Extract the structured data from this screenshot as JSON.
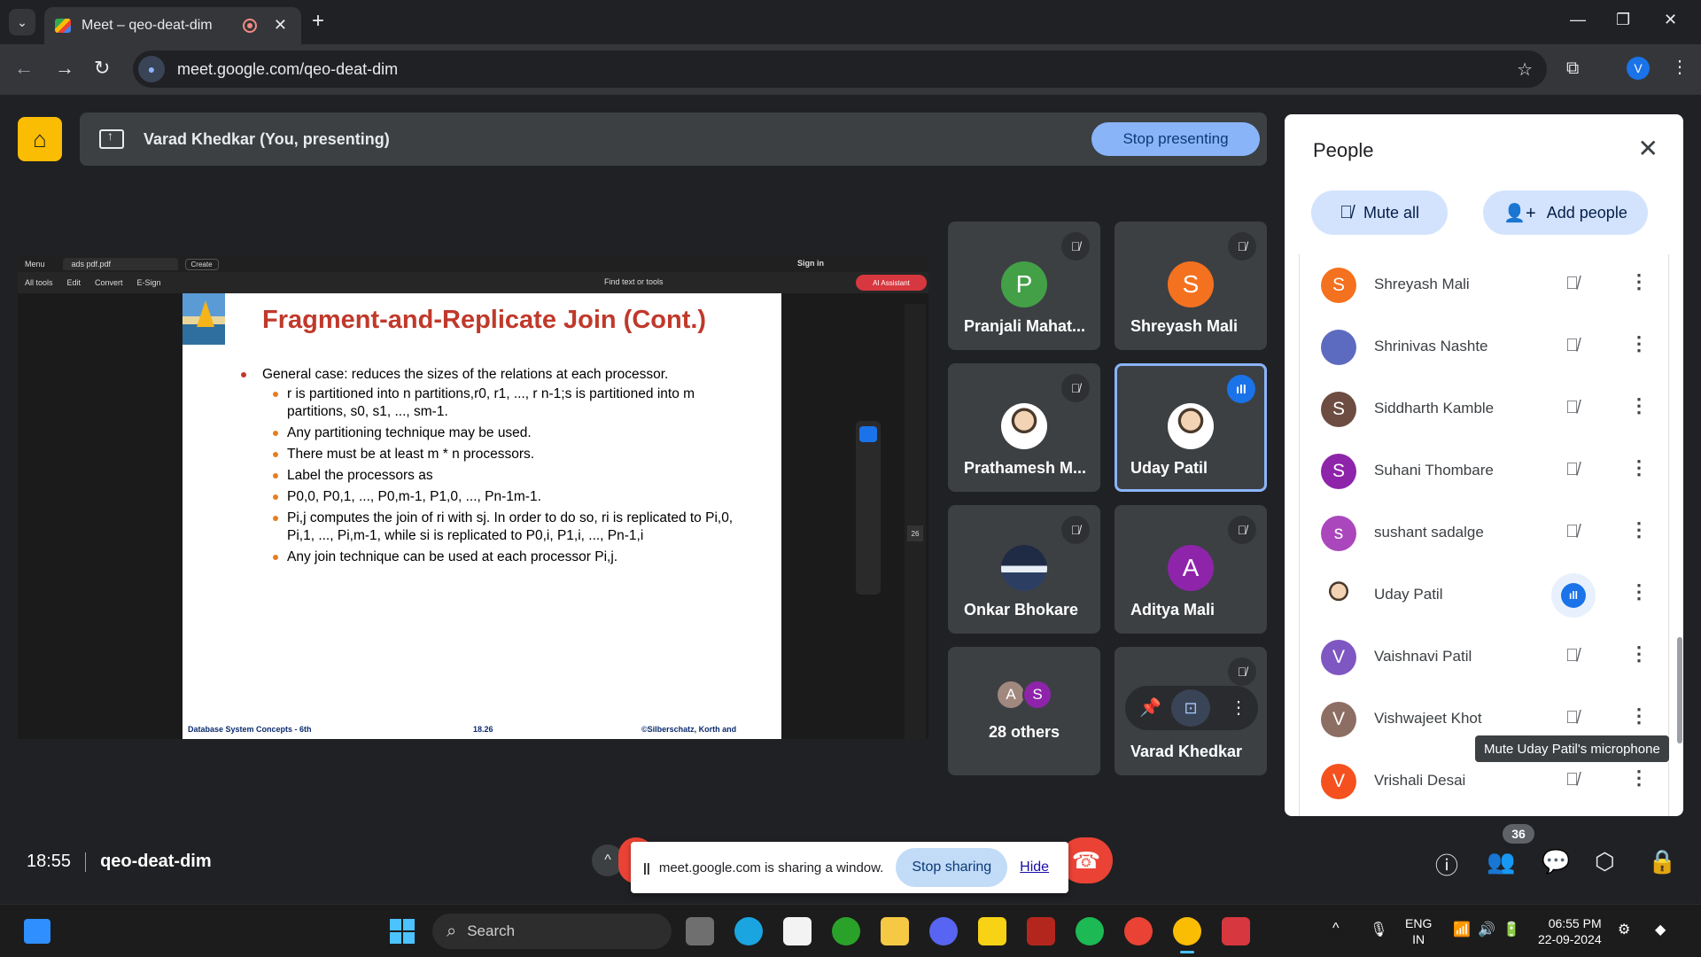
{
  "browser": {
    "tab_title": "Meet – qeo-deat-dim",
    "url": "meet.google.com/qeo-deat-dim",
    "profile_initial": "V"
  },
  "meet": {
    "presenting_text": "Varad Khedkar (You, presenting)",
    "stop_presenting": "Stop presenting",
    "time": "18:55",
    "meeting_code": "qeo-deat-dim",
    "participant_count": "36"
  },
  "shared_window": {
    "menu": "Menu",
    "file_tab": "ads pdf.pdf",
    "create": "Create",
    "sign_in": "Sign in",
    "tools": [
      "All tools",
      "Edit",
      "Convert",
      "E-Sign"
    ],
    "find": "Find text or tools",
    "ai_assistant": "AI Assistant",
    "page_number": "26",
    "slide": {
      "title": "Fragment-and-Replicate Join (Cont.)",
      "bullet_main": "General case: reduces the sizes of the relations at each processor.",
      "bullets": [
        "r is partitioned into n partitions,r0, r1, ..., r n-1;s is partitioned into m partitions, s0, s1, ..., sm-1.",
        "Any partitioning technique may be used.",
        "There must be at least m * n processors.",
        "Label the processors as",
        "P0,0, P0,1, ..., P0,m-1, P1,0, ..., Pn-1m-1.",
        "Pi,j computes the join of ri with sj. In order to do so, ri is replicated to Pi,0, Pi,1, ..., Pi,m-1, while si is replicated to P0,i, P1,i, ..., Pn-1,i",
        "Any join technique can be used at each processor Pi,j."
      ],
      "footer_left": "Database System Concepts - 6th",
      "footer_mid": "18.26",
      "footer_right": "©Silberschatz, Korth and"
    }
  },
  "tiles": [
    {
      "name": "Pranjali Mahat...",
      "initial": "P",
      "color": "#43a047"
    },
    {
      "name": "Shreyash Mali",
      "initial": "S",
      "color": "#f4711f"
    },
    {
      "name": "Prathamesh M...",
      "initial": "",
      "color": ""
    },
    {
      "name": "Uday Patil",
      "initial": "",
      "color": ""
    },
    {
      "name": "Onkar Bhokare",
      "initial": "",
      "color": ""
    },
    {
      "name": "Aditya Mali",
      "initial": "A",
      "color": "#8e24aa"
    },
    {
      "name": "28 others",
      "initial": "",
      "color": ""
    },
    {
      "name": "Varad Khedkar",
      "initial": "",
      "color": ""
    }
  ],
  "others_avatars": [
    {
      "initial": "A",
      "color": "#a1887f"
    },
    {
      "initial": "S",
      "color": "#8e24aa"
    }
  ],
  "people_panel": {
    "title": "People",
    "mute_all": "Mute all",
    "add_people": "Add people",
    "tooltip": "Mute Uday Patil's microphone",
    "list": [
      {
        "name": "Shreyash Mali",
        "initial": "S",
        "color": "#f4711f"
      },
      {
        "name": "Shrinivas Nashte",
        "initial": "",
        "color": "#5c6bc0"
      },
      {
        "name": "Siddharth Kamble",
        "initial": "S",
        "color": "#6d4c41"
      },
      {
        "name": "Suhani Thombare",
        "initial": "S",
        "color": "#8e24aa"
      },
      {
        "name": "sushant sadalge",
        "initial": "s",
        "color": "#ab47bc"
      },
      {
        "name": "Uday Patil",
        "initial": "",
        "color": "#bdbdbd"
      },
      {
        "name": "Vaishnavi Patil",
        "initial": "V",
        "color": "#7e57c2"
      },
      {
        "name": "Vishwajeet Khot",
        "initial": "V",
        "color": "#8d6e63"
      },
      {
        "name": "Vrishali Desai",
        "initial": "V",
        "color": "#f4511e"
      }
    ]
  },
  "share_banner": {
    "text": "meet.google.com is sharing a window.",
    "stop_sharing": "Stop sharing",
    "hide": "Hide"
  },
  "taskbar": {
    "search": "Search",
    "lang_top": "ENG",
    "lang_bottom": "IN",
    "time": "06:55 PM",
    "date": "22-09-2024"
  }
}
